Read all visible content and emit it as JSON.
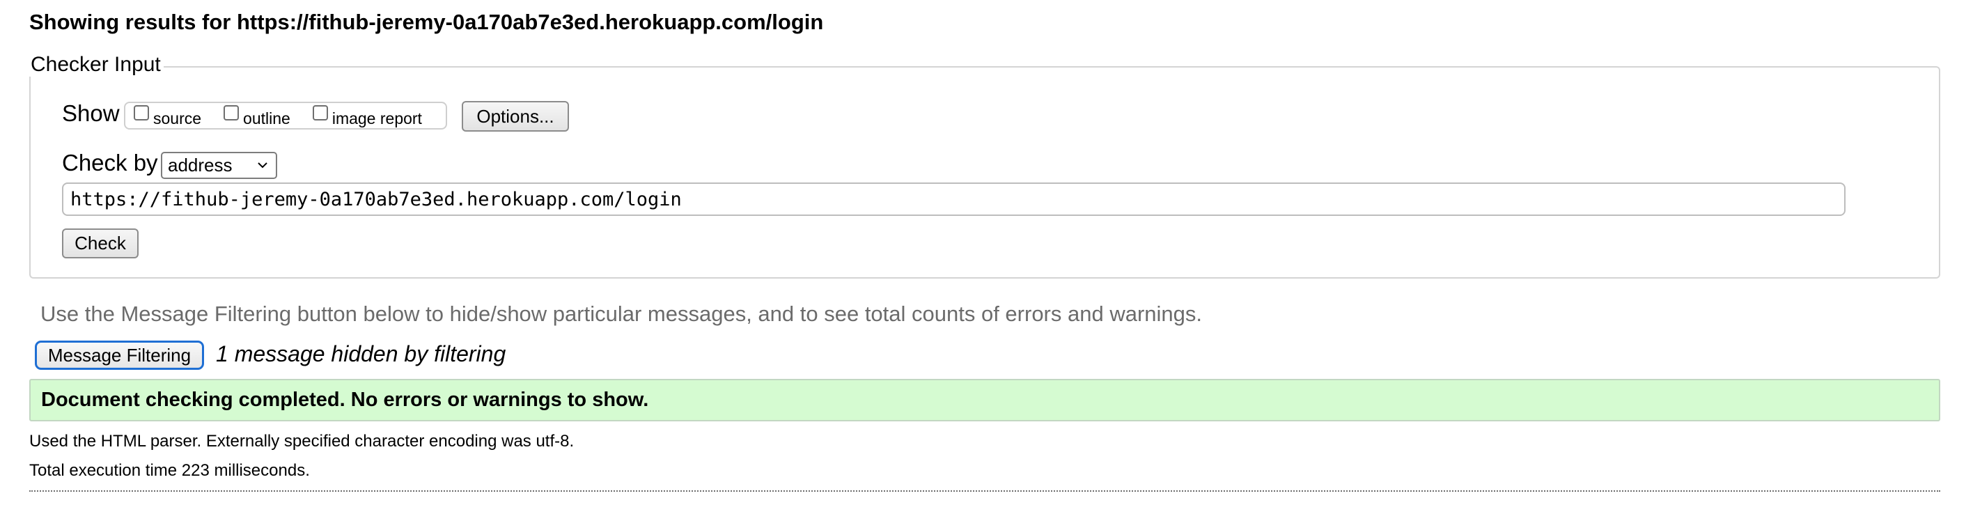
{
  "header": {
    "title": "Showing results for https://fithub-jeremy-0a170ab7e3ed.herokuapp.com/login"
  },
  "checker_input": {
    "legend": "Checker Input",
    "show_label": "Show",
    "show_options": [
      {
        "label": "source",
        "checked": false
      },
      {
        "label": "outline",
        "checked": false
      },
      {
        "label": "image report",
        "checked": false
      }
    ],
    "options_button": "Options...",
    "check_by_label": "Check by",
    "check_by_value": "address",
    "url_value": "https://fithub-jeremy-0a170ab7e3ed.herokuapp.com/login",
    "check_button": "Check"
  },
  "filtering": {
    "hint": "Use the Message Filtering button below to hide/show particular messages, and to see total counts of errors and warnings.",
    "button_label": "Message Filtering",
    "hidden_count_text": "1 message hidden by filtering"
  },
  "result": {
    "banner": "Document checking completed. No errors or warnings to show.",
    "banner_color": "#d5fbd1",
    "parser_info": "Used the HTML parser. Externally specified character encoding was utf-8.",
    "exec_time": "Total execution time 223 milliseconds."
  },
  "icons": {
    "select_chevron": "chevron-down-icon"
  }
}
